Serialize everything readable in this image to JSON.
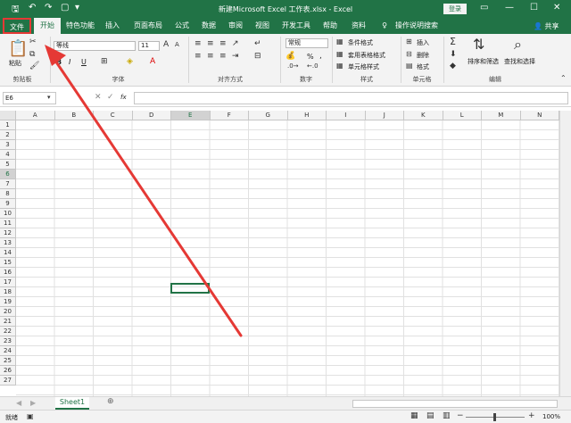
{
  "window": {
    "title": "新建Microsoft Excel 工作表.xlsx  -  Excel",
    "login": "登录"
  },
  "tabs": [
    {
      "label": "文件"
    },
    {
      "label": "开始"
    },
    {
      "label": "特色功能"
    },
    {
      "label": "插入"
    },
    {
      "label": "页面布局"
    },
    {
      "label": "公式"
    },
    {
      "label": "数据"
    },
    {
      "label": "审阅"
    },
    {
      "label": "视图"
    },
    {
      "label": "开发工具"
    },
    {
      "label": "帮助"
    },
    {
      "label": "资料"
    },
    {
      "label": "操作说明搜索"
    }
  ],
  "share_label": "共享",
  "ribbon": {
    "clipboard": {
      "paste": "粘贴",
      "group": "剪贴板"
    },
    "font": {
      "name": "等线",
      "size": "11",
      "group": "字体",
      "bold": "B",
      "italic": "I",
      "underline": "U"
    },
    "alignment": {
      "group": "对齐方式"
    },
    "number": {
      "format": "常规",
      "group": "数字",
      "percent": "%"
    },
    "styles": {
      "conditional": "条件格式",
      "table": "套用表格格式",
      "cell": "单元格样式",
      "group": "样式"
    },
    "cells": {
      "insert": "插入",
      "delete": "删除",
      "format": "格式",
      "group": "单元格"
    },
    "editing": {
      "sort": "排序和筛选",
      "find": "查找和选择",
      "group": "编辑"
    }
  },
  "formula_bar": {
    "name_box": "E6",
    "fx": "fx",
    "value": ""
  },
  "columns": [
    "A",
    "B",
    "C",
    "D",
    "E",
    "F",
    "G",
    "H",
    "I",
    "J",
    "K",
    "L",
    "M",
    "N"
  ],
  "rows": [
    "1",
    "2",
    "3",
    "4",
    "5",
    "6",
    "7",
    "8",
    "9",
    "10",
    "11",
    "12",
    "13",
    "14",
    "15",
    "16",
    "17",
    "18",
    "19",
    "20",
    "21",
    "22",
    "23",
    "24",
    "25",
    "26",
    "27"
  ],
  "active_cell": "E6",
  "sheets": [
    {
      "name": "Sheet1"
    }
  ],
  "status": {
    "ready": "就绪",
    "zoom": "100%"
  },
  "colors": {
    "accent": "#217346",
    "highlight": "#e53935"
  }
}
